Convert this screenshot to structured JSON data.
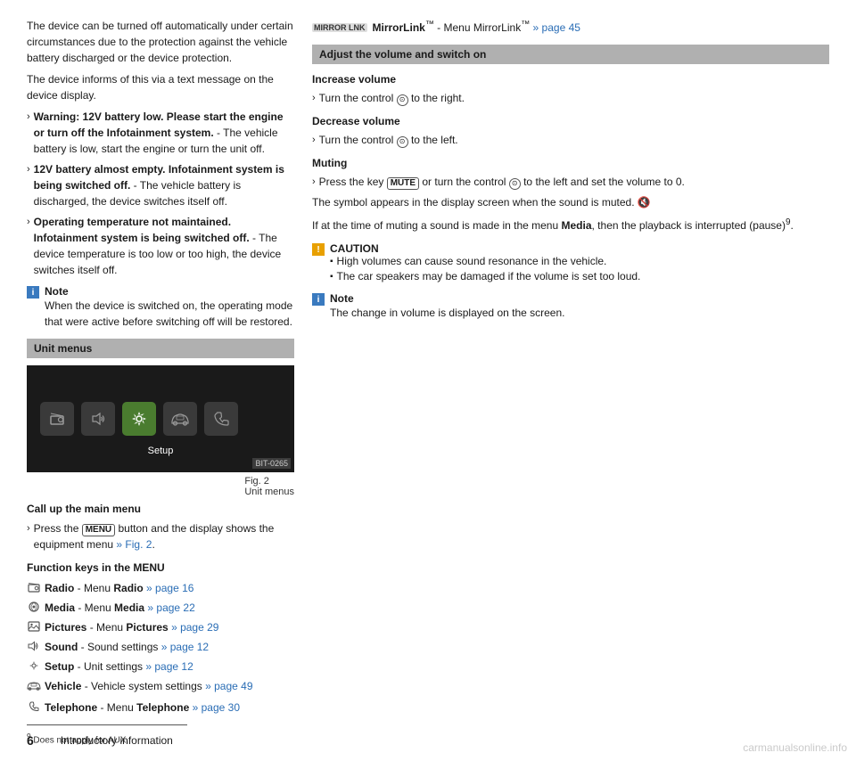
{
  "page": {
    "number": "6",
    "title": "Introductory information"
  },
  "left": {
    "intro_para1": "The device can be turned off automatically under certain circumstances due to the protection against the vehicle battery discharged or the device protection.",
    "intro_para2": "The device informs of this via a text message on the device display.",
    "warning_items": [
      {
        "id": "w1",
        "bold_part": "Warning: 12V battery low. Please start the engine or turn off the Infotainment system.",
        "rest": " - The vehicle battery is low, start the engine or turn the unit off."
      },
      {
        "id": "w2",
        "bold_part": "12V battery almost empty. Infotainment system is being switched off.",
        "rest": " - The vehicle battery is discharged, the device switches itself off."
      },
      {
        "id": "w3",
        "bold_part": "Operating temperature not maintained. Infotainment system is being switched off.",
        "rest": " - The device temperature is too low or too high, the device switches itself off."
      }
    ],
    "note_label": "Note",
    "note_text": "When the device is switched on, the operating mode that were active before switching off will be restored.",
    "unit_menus_header": "Unit menus",
    "fig_label": "Fig. 2",
    "fig_sublabel": "Unit menus",
    "fig_number": "BIT-0265",
    "setup_label": "Setup",
    "call_up_header": "Call up the main menu",
    "call_up_text": "Press the",
    "call_up_button": "MENU",
    "call_up_rest": "button and the display shows the equipment menu",
    "call_up_link": "» Fig. 2",
    "function_keys_header": "Function keys in the MENU",
    "functions": [
      {
        "id": "f1",
        "icon": "radio",
        "label": "Radio",
        "dash": " - Menu ",
        "bold": "Radio",
        "link": "» page 16"
      },
      {
        "id": "f2",
        "icon": "media",
        "label": "Media",
        "dash": " - Menu ",
        "bold": "Media",
        "link": "» page 22"
      },
      {
        "id": "f3",
        "icon": "pictures",
        "label": "Pictures",
        "dash": " - Menu ",
        "bold": "Pictures",
        "link": "» page 29"
      },
      {
        "id": "f4",
        "icon": "sound",
        "label": "Sound",
        "dash": " - ",
        "bold": "Sound settings",
        "link": "» page 12"
      },
      {
        "id": "f5",
        "icon": "setup",
        "label": "Setup",
        "dash": " - ",
        "bold": "Unit settings",
        "link": "» page 12"
      },
      {
        "id": "f6",
        "icon": "vehicle",
        "label": "Vehicle",
        "dash": " - ",
        "bold": "Vehicle system settings",
        "link": "» page 49"
      }
    ],
    "footnote_sup": "9",
    "footnote_text": "Does not apply for AUX."
  },
  "right": {
    "header_items": [
      {
        "icon": "phone",
        "text_pre": "Telephone",
        "dash": " - Menu ",
        "bold": "Telephone",
        "link": "» page 30"
      },
      {
        "icon": "mirrorlink",
        "tag": "MIRROR LINK",
        "text_pre": "MirrorLink",
        "sup": "TM",
        "dash": " - Menu MirrorLink",
        "sup2": "TM",
        "link": "» page 45"
      }
    ],
    "adjust_header": "Adjust the volume and switch on",
    "increase_label": "Increase volume",
    "increase_text": "Turn the control",
    "increase_dir": "to the right.",
    "decrease_label": "Decrease volume",
    "decrease_text": "Turn the control",
    "decrease_dir": "to the left.",
    "muting_label": "Muting",
    "muting_text_pre": "Press the key",
    "muting_key": "MUTE",
    "muting_text_mid": "or turn the control",
    "muting_text_end": "to the left and set the volume to 0.",
    "symbol_text": "The symbol appears in the display screen when the sound is muted.",
    "if_muting_text": "If at the time of muting a sound is made in the menu",
    "if_muting_bold": "Media",
    "if_muting_end": ", then the playback is interrupted (pause)",
    "if_muting_sup": "9",
    "caution_label": "CAUTION",
    "caution_items": [
      "High volumes can cause sound resonance in the vehicle.",
      "The car speakers may be damaged if the volume is set too loud."
    ],
    "note2_label": "Note",
    "note2_text": "The change in volume is displayed on the screen."
  }
}
